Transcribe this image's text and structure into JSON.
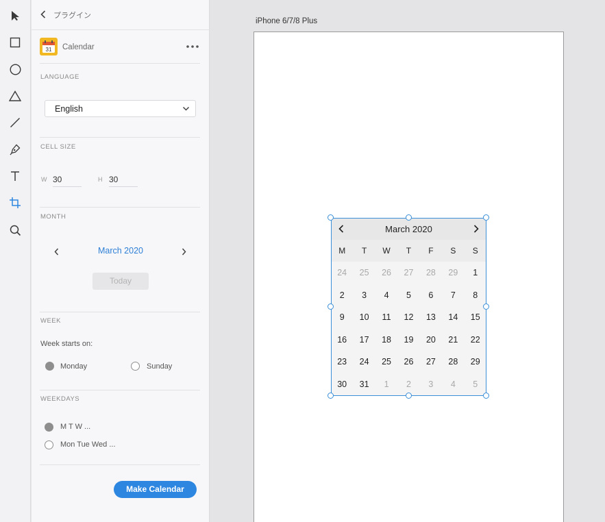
{
  "toolbar": {
    "tools": [
      {
        "name": "select-tool",
        "icon": "arrow-pointer-icon"
      },
      {
        "name": "rectangle-tool",
        "icon": "rectangle-icon"
      },
      {
        "name": "ellipse-tool",
        "icon": "ellipse-icon"
      },
      {
        "name": "polygon-tool",
        "icon": "triangle-icon"
      },
      {
        "name": "line-tool",
        "icon": "line-icon"
      },
      {
        "name": "pen-tool",
        "icon": "pen-icon"
      },
      {
        "name": "text-tool",
        "icon": "text-icon"
      },
      {
        "name": "artboard-tool",
        "icon": "artboard-icon"
      },
      {
        "name": "zoom-tool",
        "icon": "search-icon"
      }
    ],
    "active_tool": "artboard-tool",
    "accent_color": "#2d86e0"
  },
  "panel": {
    "header_title": "プラグイン",
    "plugin_name": "Calendar",
    "plugin_icon_day": "31",
    "language": {
      "label": "LANGUAGE",
      "selected": "English"
    },
    "cell_size": {
      "label": "CELL SIZE",
      "w_label": "W",
      "w_value": "30",
      "h_label": "H",
      "h_value": "30"
    },
    "month": {
      "label": "MONTH",
      "value": "March 2020",
      "today_label": "Today"
    },
    "week": {
      "label": "WEEK",
      "starts_on_label": "Week starts on:",
      "option_monday": "Monday",
      "option_sunday": "Sunday",
      "selected": "Monday"
    },
    "weekdays": {
      "label": "WEEKDAYS",
      "option_short": "M T W ...",
      "option_long": "Mon Tue Wed ...",
      "selected": "short"
    },
    "make_button": "Make Calendar"
  },
  "canvas": {
    "artboard_title": "iPhone 6/7/8 Plus",
    "selection_color": "#3a8fd8",
    "calendar": {
      "title": "March 2020",
      "weekday_headers": [
        "M",
        "T",
        "W",
        "T",
        "F",
        "S",
        "S"
      ],
      "weeks": [
        [
          {
            "d": "24",
            "dim": true
          },
          {
            "d": "25",
            "dim": true
          },
          {
            "d": "26",
            "dim": true
          },
          {
            "d": "27",
            "dim": true
          },
          {
            "d": "28",
            "dim": true
          },
          {
            "d": "29",
            "dim": true
          },
          {
            "d": "1",
            "dim": false
          }
        ],
        [
          {
            "d": "2",
            "dim": false
          },
          {
            "d": "3",
            "dim": false
          },
          {
            "d": "4",
            "dim": false
          },
          {
            "d": "5",
            "dim": false
          },
          {
            "d": "6",
            "dim": false
          },
          {
            "d": "7",
            "dim": false
          },
          {
            "d": "8",
            "dim": false
          }
        ],
        [
          {
            "d": "9",
            "dim": false
          },
          {
            "d": "10",
            "dim": false
          },
          {
            "d": "11",
            "dim": false
          },
          {
            "d": "12",
            "dim": false
          },
          {
            "d": "13",
            "dim": false
          },
          {
            "d": "14",
            "dim": false
          },
          {
            "d": "15",
            "dim": false
          }
        ],
        [
          {
            "d": "16",
            "dim": false
          },
          {
            "d": "17",
            "dim": false
          },
          {
            "d": "18",
            "dim": false
          },
          {
            "d": "19",
            "dim": false
          },
          {
            "d": "20",
            "dim": false
          },
          {
            "d": "21",
            "dim": false
          },
          {
            "d": "22",
            "dim": false
          }
        ],
        [
          {
            "d": "23",
            "dim": false
          },
          {
            "d": "24",
            "dim": false
          },
          {
            "d": "25",
            "dim": false
          },
          {
            "d": "26",
            "dim": false
          },
          {
            "d": "27",
            "dim": false
          },
          {
            "d": "28",
            "dim": false
          },
          {
            "d": "29",
            "dim": false
          }
        ],
        [
          {
            "d": "30",
            "dim": false
          },
          {
            "d": "31",
            "dim": false
          },
          {
            "d": "1",
            "dim": true
          },
          {
            "d": "2",
            "dim": true
          },
          {
            "d": "3",
            "dim": true
          },
          {
            "d": "4",
            "dim": true
          },
          {
            "d": "5",
            "dim": true
          }
        ]
      ]
    }
  }
}
